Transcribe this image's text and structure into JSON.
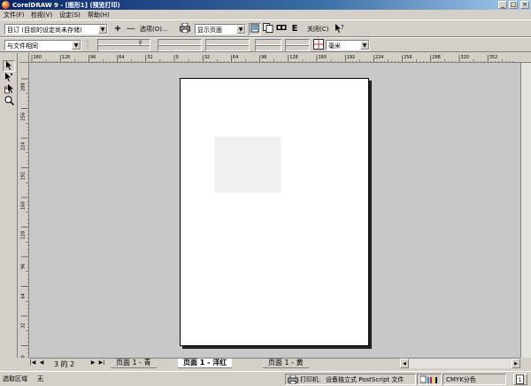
{
  "window": {
    "title": "CorelDRAW 9 - [图形1] (预览打印)",
    "controls": {
      "minimize": "_",
      "maximize": "□",
      "close": "×"
    }
  },
  "menu": [
    "文件(F)",
    "检视(V)",
    "设定(S)",
    "帮助(H)"
  ],
  "toolbar1": {
    "style_combo": "目订 (目前的设定尚未存储)",
    "add_symbol": "+",
    "remove_symbol": "—",
    "options_label": "选项(O)...",
    "view_combo": "显示页面",
    "close_label": "关闭(C)",
    "e_label": "E"
  },
  "toolbar2": {
    "layout_combo": "与文件相同",
    "units_combo": "毫米"
  },
  "ruler": {
    "top_labels": [
      "160",
      "128",
      "96",
      "64",
      "32",
      "0",
      "32",
      "64",
      "96",
      "128",
      "160",
      "192",
      "224",
      "256",
      "288",
      "320",
      "352"
    ],
    "left_labels": [
      "288",
      "256",
      "224",
      "192",
      "160",
      "128",
      "96",
      "64",
      "32",
      "0"
    ]
  },
  "tabs": {
    "page_info": "3 的 2",
    "pages": [
      "页面 1 - 青",
      "页面 1 - 洋红",
      "页面 1 - 黄"
    ],
    "active_index": 1
  },
  "status": {
    "selection_label": "选取区域",
    "selection_value": "无",
    "printer_label": "打印机:",
    "printer_value": "设备独立式 PostScript 文件",
    "color_mode": "CMYK分色"
  }
}
